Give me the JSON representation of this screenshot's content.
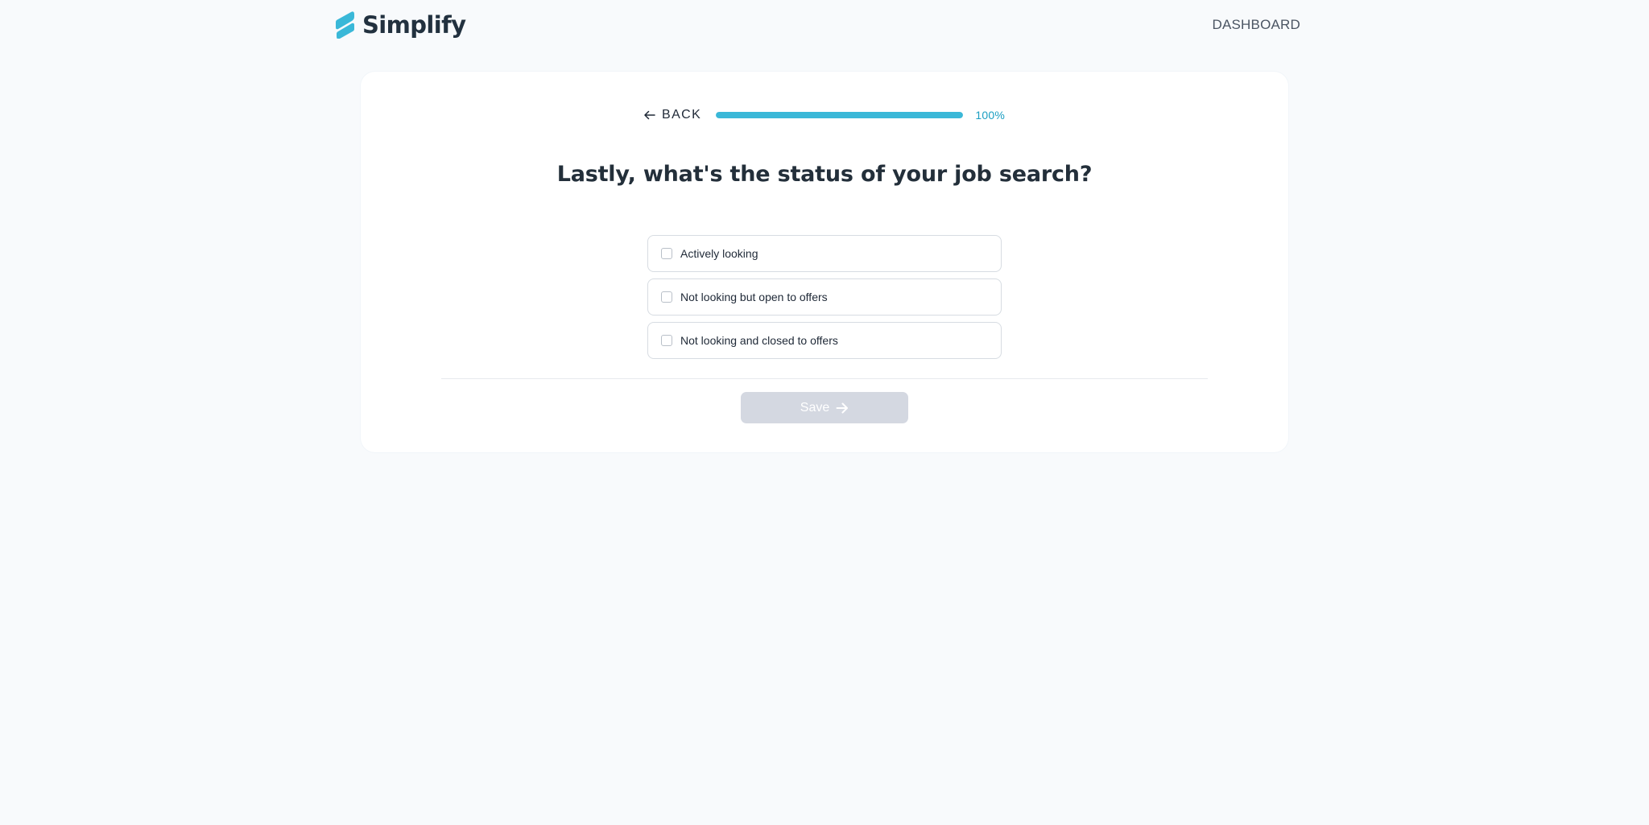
{
  "header": {
    "brand_name": "Simplify",
    "logo_icon": "simplify-logo-icon",
    "dashboard_label": "DASHBOARD"
  },
  "progress": {
    "back_label": "BACK",
    "back_icon": "arrow-left-icon",
    "percent": 100,
    "percent_label": "100%"
  },
  "question": {
    "title": "Lastly, what's the status of your job search?",
    "options": [
      {
        "label": "Actively looking",
        "checked": false
      },
      {
        "label": "Not looking but open to offers",
        "checked": false
      },
      {
        "label": "Not looking and closed to offers",
        "checked": false
      }
    ]
  },
  "actions": {
    "save_label": "Save",
    "save_icon": "arrow-right-icon",
    "save_disabled": true
  },
  "colors": {
    "accent": "#3ab8d8",
    "accent_text": "#1b9ec2",
    "disabled_button": "#d4d8e1",
    "page_background": "#f8fafc",
    "card_background": "#ffffff"
  }
}
